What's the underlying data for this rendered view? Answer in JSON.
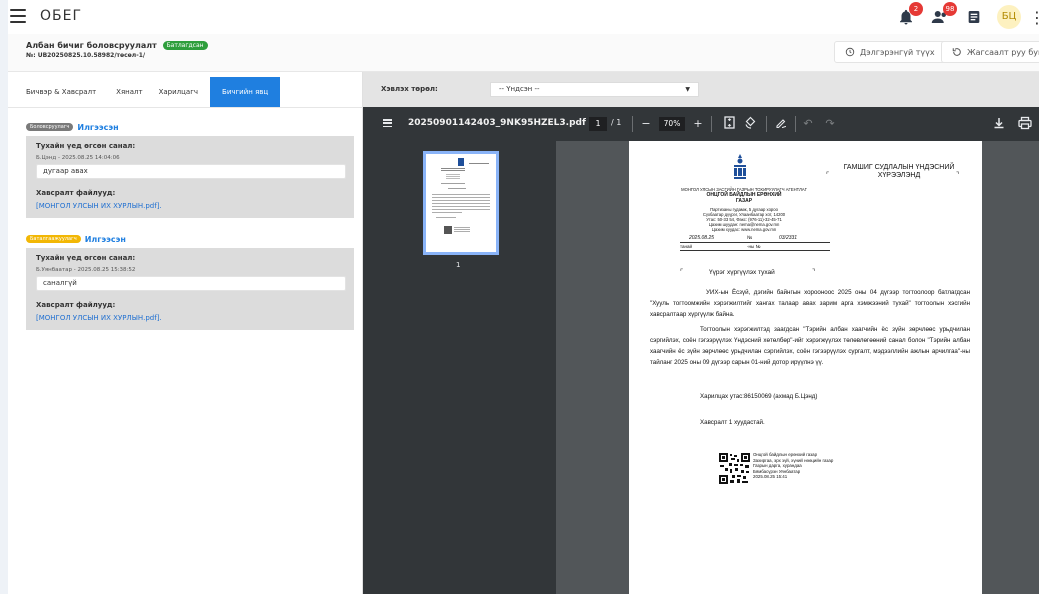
{
  "app": {
    "title": "ОБЕГ"
  },
  "top_icons": {
    "bell_badge": "2",
    "users_badge": "98",
    "avatar_initials": "БЦ"
  },
  "header": {
    "doc_title": "Албан бичиг боловсруулалт",
    "status": "Батлагдсан",
    "doc_no": "№: UB20250825.10.58982/төсөл-1/",
    "btn_long_list": "Дэлгэрэнгүй түүх",
    "btn_return": "Жагсаалт руу буцах"
  },
  "tabs": [
    {
      "label": "Бичвэр & Хавсралт"
    },
    {
      "label": "Хяналт"
    },
    {
      "label": "Харилцагч"
    },
    {
      "label": "Бичгийн явц"
    }
  ],
  "flow": [
    {
      "role": "Боловсруулагч",
      "role_color": "#7a7a7a",
      "status": "Илгээсэн",
      "comment_label": "Тухайн үед өгсөн санал:",
      "meta": "Б.Цэнд - 2025.08.25 14:04:06",
      "comment": "дугаар авах",
      "files_label": "Хавсралт файлууд:",
      "file_link": "[МОНГОЛ УЛСЫН ИХ ХУРЛЫН.pdf]."
    },
    {
      "role": "Баталгаажуулагч",
      "role_color": "#f2b705",
      "status": "Илгээсэн",
      "comment_label": "Тухайн үед өгсөн санал:",
      "meta": "Б.Уянбаатар - 2025.08.25 15:38:52",
      "comment": "саналгүй",
      "files_label": "Хавсралт файлууд:",
      "file_link": "[МОНГОЛ УЛСЫН ИХ ХУРЛЫН.pdf]."
    }
  ],
  "viewer": {
    "type_label": "Хэвлэх төрөл:",
    "type_value": "-- Үндсэн --"
  },
  "pdf": {
    "filename": "20250901142403_9NK95HZEL3.pdf",
    "page_current": "1",
    "page_total": "/ 1",
    "zoom": "70%",
    "thumb_number": "1"
  },
  "document": {
    "org_lines": [
      "МОНГОЛ УЛСЫН ЗАСГИЙН ГАЗРЫН ТОХИРУУЛАГЧ АГЕНТЛАГ",
      "ОНЦГОЙ БАЙДЛЫН ЕРӨНХИЙ",
      "ГАЗАР"
    ],
    "org_address": [
      "Партизаны гудамж, 5 дугаар хороо",
      "Сүхбаатар дүүрэг, Улаанбаатар хот, 14200",
      "Утас: 50-33 54, Факс: (976-11)-32-45-71",
      "Цахим шуудан: nema@nema.gov.mn",
      "Цахим хуудас: www.nema.gov.mn"
    ],
    "date": "2025.08.25",
    "no_label": "№",
    "number": "03/2331",
    "to_label": "танай",
    "to_no": "-ны №",
    "recipient": "ГАМШИГ СУДЛАЛЫН ҮНДЭСНИЙ ХҮРЭЭЛЭНД",
    "subject": "Үүрэг хүргүүлэх тухай",
    "paragraphs": [
      "УИХ-ын Ёсзүй, дэгийн байнгын хорооноос 2025 оны 04 дүгээр тогтоолоор батлагдсан \"Хууль тогтоомжийн хэрэгжилтийг хангах талаар авах зарим арга хэмжээний тухай\" тогтоолын хэсгийн хавсралтаар хүргүүлж байна.",
      "Тогтоолын хэрэгжилтэд заагдсан \"Тэрийн албан хаагчийн ёс зүйн зөрчлөөс урьдчилан сэргийлэх, соён гэгээрүүлэх Үндэсний хөтөлбөр\"-ийг хэрэгжүүлэх төлөвлөгөөний санал болон \"Тэрийн албан хаагчийн ёс зүйн зөрчлөөс урьдчилан сэргийлэх, соён гэгээрүүлэх сургалт, мэдээллийн ажлын арчилгаа\"-ны тайланг 2025 оны 09 дүгээр сарын 01-ний дотор ирүүлнэ үү."
    ],
    "contact": "Харилцах утас:86150069 (ахмад Б.Цэнд)",
    "attachment": "Хавсралт 1 хуудастай.",
    "signature": [
      "Онцгой байдлын ерөнхий газар",
      "Захиргаа, эрх зүй, хүний нөөцийн газар",
      "Газрын дарга, хурандаа",
      "Бямбасүрэн Уянбаатар",
      "2025.08.25 15:41"
    ]
  }
}
